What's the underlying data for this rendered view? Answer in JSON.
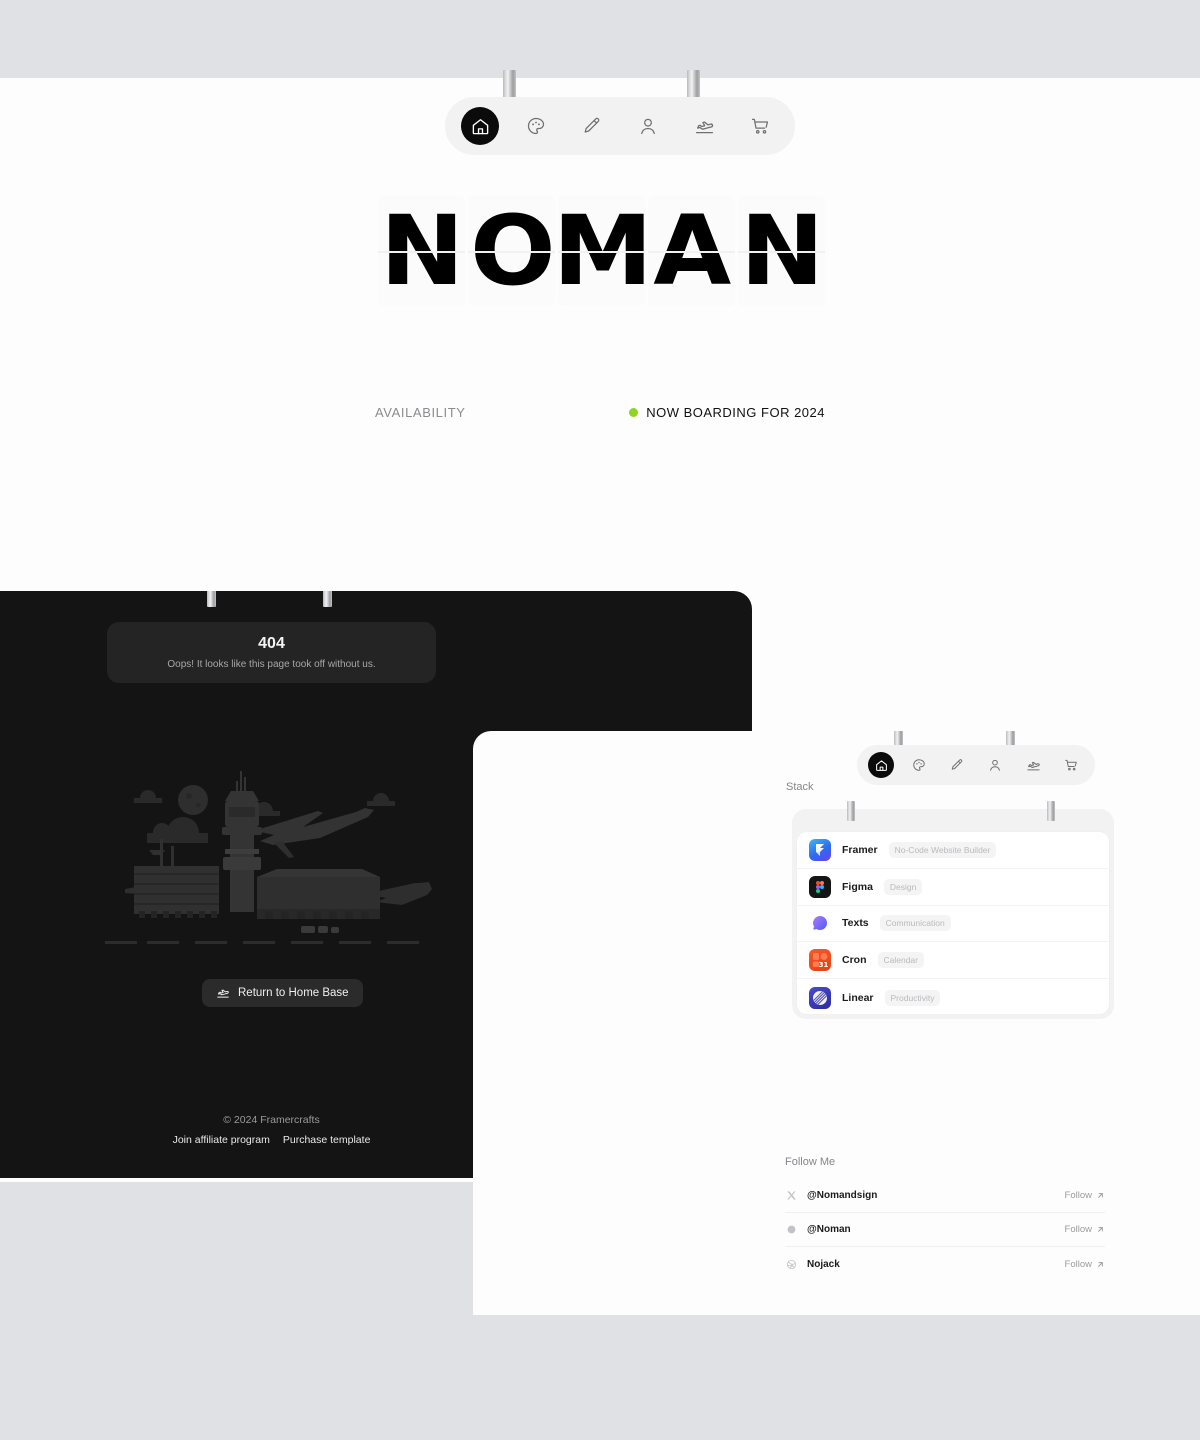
{
  "brand": {
    "letters": [
      "N",
      "O",
      "M",
      "A",
      "N"
    ]
  },
  "nav": {
    "items": [
      {
        "name": "home-icon",
        "label": "Home",
        "active": true
      },
      {
        "name": "palette-icon",
        "label": "Design",
        "active": false
      },
      {
        "name": "pencil-icon",
        "label": "Write",
        "active": false
      },
      {
        "name": "user-icon",
        "label": "About",
        "active": false
      },
      {
        "name": "plane-icon",
        "label": "Travel",
        "active": false
      },
      {
        "name": "cart-icon",
        "label": "Shop",
        "active": false
      }
    ]
  },
  "hero": {
    "availability_label": "AVAILABILITY",
    "status_text": "NOW BOARDING FOR 2024",
    "status_color": "#8fd420"
  },
  "error_page": {
    "code": "404",
    "message": "Oops! It looks like this page took off without us.",
    "button_label": "Return to Home Base",
    "button_icon": "plane-takeoff-icon"
  },
  "footer": {
    "copyright": "© 2024 Framercrafts",
    "links": [
      {
        "label": "Join affiliate program"
      },
      {
        "label": "Purchase template"
      }
    ]
  },
  "stack": {
    "title": "Stack",
    "items": [
      {
        "name": "Framer",
        "tag": "No-Code Website Builder",
        "icon": "framer-icon"
      },
      {
        "name": "Figma",
        "tag": "Design",
        "icon": "figma-icon"
      },
      {
        "name": "Texts",
        "tag": "Communication",
        "icon": "texts-icon"
      },
      {
        "name": "Cron",
        "tag": "Calendar",
        "icon": "cron-icon"
      },
      {
        "name": "Linear",
        "tag": "Productivity",
        "icon": "linear-icon"
      }
    ]
  },
  "follow": {
    "title": "Follow Me",
    "action_label": "Follow",
    "items": [
      {
        "handle": "@Nomandsign",
        "icon": "x-twitter-icon"
      },
      {
        "handle": "@Noman",
        "icon": "threads-icon"
      },
      {
        "handle": "Nojack",
        "icon": "dribbble-icon"
      }
    ]
  }
}
